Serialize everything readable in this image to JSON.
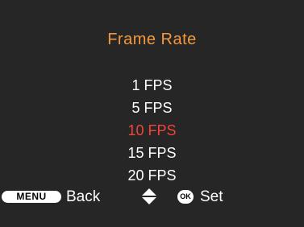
{
  "colors": {
    "background": "#262626",
    "title": "#f3983e",
    "option": "#ffffff",
    "selected": "#f2443a"
  },
  "screen": {
    "title": "Frame Rate"
  },
  "options": [
    {
      "label": "1 FPS",
      "selected": false
    },
    {
      "label": "5 FPS",
      "selected": false
    },
    {
      "label": "10 FPS",
      "selected": true
    },
    {
      "label": "15 FPS",
      "selected": false
    },
    {
      "label": "20 FPS",
      "selected": false
    }
  ],
  "footer": {
    "menu_button": "MENU",
    "back_label": "Back",
    "nav_icon": "up-down-arrows",
    "ok_button": "OK",
    "set_label": "Set"
  }
}
